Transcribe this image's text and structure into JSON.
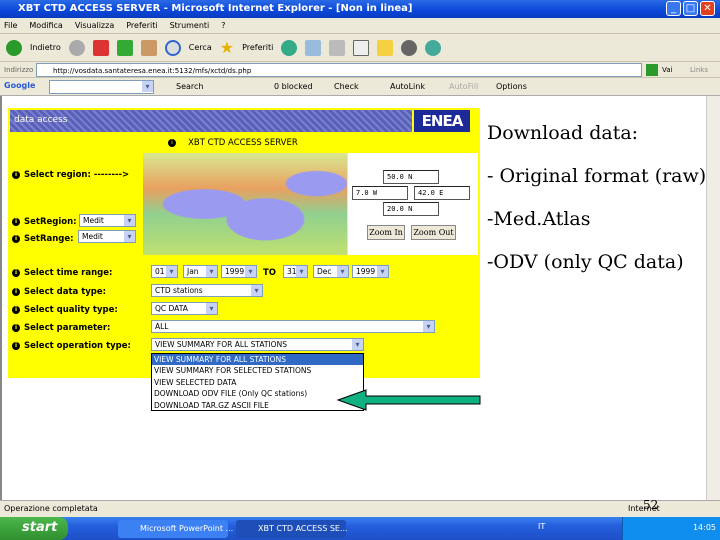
{
  "window": {
    "title": "XBT CTD ACCESS SERVER - Microsoft Internet Explorer - [Non in linea]"
  },
  "menu": [
    "File",
    "Modifica",
    "Visualizza",
    "Preferiti",
    "Strumenti",
    "?"
  ],
  "toolbar": {
    "back": "Indietro",
    "search": "Cerca",
    "favorites": "Preferiti"
  },
  "address": {
    "label": "Indirizzo",
    "url": "http://vosdata.santateresa.enea.it:5132/mfs/xctd/ds.php",
    "go": "Vai",
    "links": "Links"
  },
  "google": {
    "logo": "Google",
    "search": "Search",
    "blocked": "0 blocked",
    "check": "Check",
    "autolink": "AutoLink",
    "autofill": "AutoFill",
    "options": "Options"
  },
  "page": {
    "banner": "data access",
    "logo": "ENEA",
    "heading": "XBT CTD ACCESS SERVER",
    "select_region": "Select region: -------->",
    "set_region_label": "SetRegion:",
    "set_region_value": "Medit",
    "set_range_label": "SetRange:",
    "set_range_value": "Medit",
    "coords": {
      "north": "50.0 N",
      "west": "7.0 W",
      "east": "42.0 E",
      "south": "20.0 N"
    },
    "zoom_in": "Zoom In",
    "zoom_out": "Zoom Out",
    "time_label": "Select time range:",
    "from_day": "01",
    "from_month": "Jan",
    "from_year": "1999",
    "to": "TO",
    "to_day": "31",
    "to_month": "Dec",
    "to_year": "1999",
    "data_type_label": "Select data type:",
    "data_type": "CTD stations",
    "quality_label": "Select quality type:",
    "quality": "QC DATA",
    "parameter_label": "Select parameter:",
    "parameter": "ALL",
    "operation_label": "Select operation type:",
    "operation": "VIEW SUMMARY FOR ALL STATIONS",
    "operation_options": [
      "VIEW SUMMARY FOR ALL STATIONS",
      "VIEW SUMMARY FOR SELECTED STATIONS",
      "VIEW SELECTED DATA",
      "DOWNLOAD ODV FILE (Only QC stations)",
      "DOWNLOAD TAR.GZ ASCII FILE"
    ]
  },
  "side_text": [
    "Download data:",
    "- Original format (raw)",
    "-Med.Atlas",
    "-ODV (only QC data)"
  ],
  "status": {
    "text": "Operazione completata",
    "zone": "Internet",
    "page_number": "52"
  },
  "taskbar": {
    "start": "start",
    "tasks": [
      "Microsoft PowerPoint ...",
      "XBT CTD ACCESS SE..."
    ],
    "lang": "IT",
    "clock": "14:05"
  },
  "colors": {
    "panel": "#ffff00",
    "arrow": "#10b080",
    "highlight": "#316ac5"
  }
}
